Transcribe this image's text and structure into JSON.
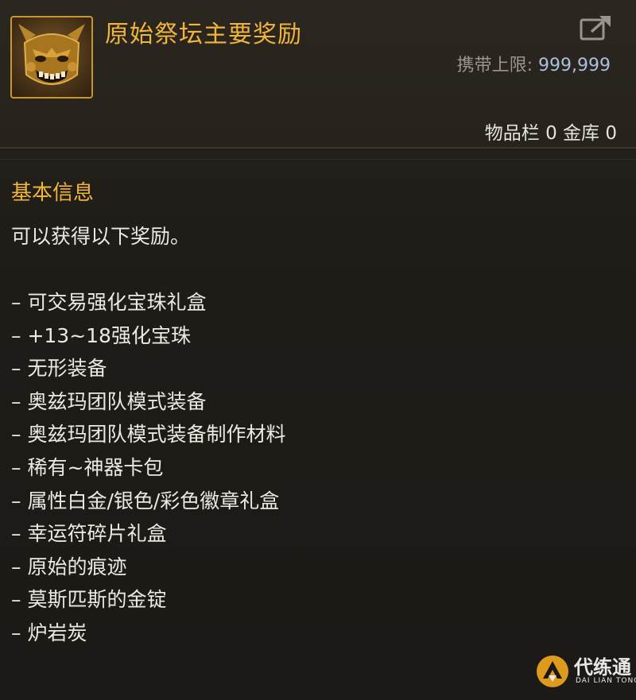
{
  "item": {
    "name": "原始祭坛主要奖励",
    "icon": "golden-demon-mask-icon",
    "carry_limit_label": "携带上限:",
    "carry_limit_value": "999,999",
    "inventory_label": "物品栏",
    "inventory_count": "0",
    "vault_label": "金库",
    "vault_count": "0"
  },
  "info": {
    "section_title": "基本信息",
    "description": "可以获得以下奖励。",
    "rewards": [
      "– 可交易强化宝珠礼盒",
      "– +13~18强化宝珠",
      "– 无形装备",
      "– 奥兹玛团队模式装备",
      "– 奥兹玛团队模式装备制作材料",
      "– 稀有~神器卡包",
      "– 属性白金/银色/彩色徽章礼盒",
      "– 幸运符碎片礼盒",
      "– 原始的痕迹",
      "– 莫斯匹斯的金锭",
      "– 炉岩炭"
    ]
  },
  "watermark": {
    "logo_icon": "dailiantong-logo-icon",
    "text": "代练通",
    "subtext": "DAI LIAN TONG"
  },
  "colors": {
    "title_gold": "#f0b53a",
    "body_text": "#ece9e2",
    "carry_value_blue": "#a9c0dc",
    "panel_bg": "#1f1c18",
    "icon_border": "#c9962d"
  }
}
